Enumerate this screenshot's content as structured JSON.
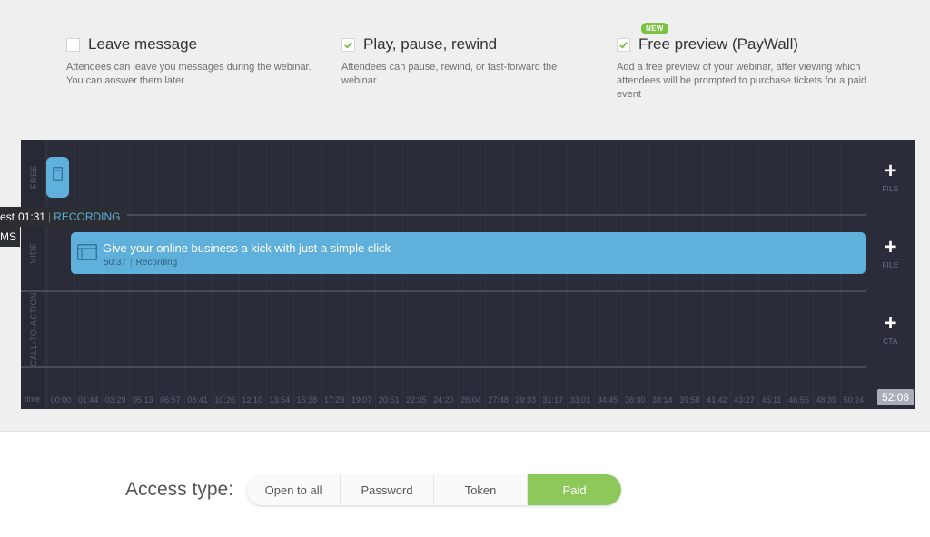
{
  "options": [
    {
      "id": "leave-message",
      "title": "Leave message",
      "checked": false,
      "desc": "Attendees can leave you messages during the webinar. You can answer them later."
    },
    {
      "id": "play-pause-rewind",
      "title": "Play, pause, rewind",
      "checked": true,
      "desc": "Attendees can pause, rewind, or fast-forward the webinar."
    },
    {
      "id": "free-preview",
      "title": "Free preview (PayWall)",
      "checked": true,
      "badge": "NEW",
      "desc": "Add a free preview of your webinar, after viewing which attendees will be prompted to purchase tickets for a paid event"
    }
  ],
  "timeline": {
    "tracks": {
      "free": "FREE",
      "video": "VIDE",
      "cta": "CALL-TO-ACTION"
    },
    "add_buttons": {
      "file1": "FILE",
      "file2": "FILE",
      "cta": "CTA"
    },
    "video_clip": {
      "title": "Give your online business a kick with just a simple click",
      "duration": "50:37",
      "type": "Recording"
    },
    "time_label": "time",
    "ticks": [
      "00:00",
      "01:44",
      "03:29",
      "05:13",
      "06:57",
      "08:41",
      "10:26",
      "12:10",
      "13:54",
      "15:38",
      "17:23",
      "19:07",
      "20:51",
      "22:35",
      "24:20",
      "26:04",
      "27:48",
      "29:33",
      "31:17",
      "33:01",
      "34:45",
      "36:30",
      "38:14",
      "39:58",
      "41:42",
      "43:27",
      "45:11",
      "46:55",
      "48:39",
      "50:24"
    ],
    "end_time": "52:08",
    "tooltip": {
      "name": "est",
      "time": "01:31",
      "state": "RECORDING",
      "line2": "MS"
    }
  },
  "access": {
    "label": "Access type:",
    "options": [
      "Open to all",
      "Password",
      "Token",
      "Paid"
    ],
    "selected": "Paid"
  },
  "colors": {
    "accent_blue": "#5fb0da",
    "accent_green": "#8cc85a",
    "timeline_bg": "#2a2d39"
  }
}
